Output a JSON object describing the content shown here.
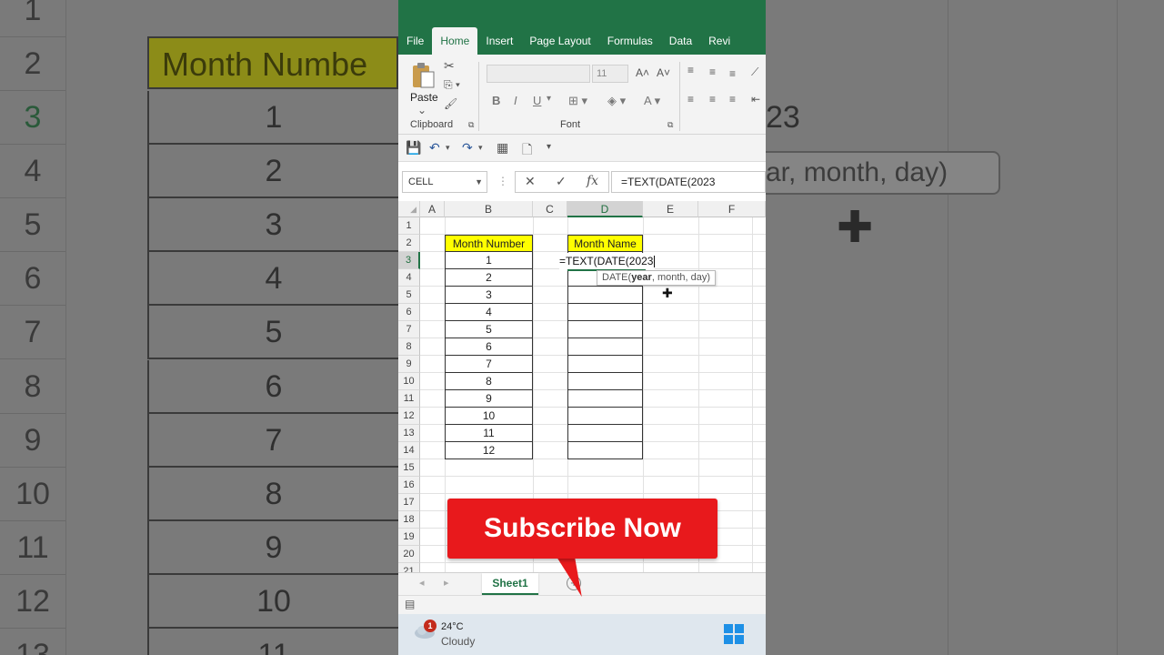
{
  "background": {
    "row_numbers": [
      "1",
      "2",
      "3",
      "4",
      "5",
      "6",
      "7",
      "8",
      "9",
      "10",
      "11",
      "12",
      "13"
    ],
    "header_text": "Month Numbe",
    "values": [
      "1",
      "2",
      "3",
      "4",
      "5",
      "6",
      "7",
      "8",
      "9",
      "10",
      "11"
    ],
    "right_cell_text": "23",
    "tooltip_text": "ar, month, day)"
  },
  "ribbon": {
    "tabs": [
      "File",
      "Home",
      "Insert",
      "Page Layout",
      "Formulas",
      "Data",
      "Revi"
    ],
    "active_tab": "Home",
    "paste_label": "Paste",
    "clipboard_label": "Clipboard",
    "font_label": "Font",
    "font_size": "11",
    "bold": "B",
    "italic": "I",
    "underline": "U"
  },
  "formula_bar": {
    "name_box": "CELL",
    "cancel": "✕",
    "enter": "✓",
    "fx": "fx",
    "formula": "=TEXT(DATE(2023"
  },
  "sheet": {
    "columns": [
      "A",
      "B",
      "C",
      "D",
      "E",
      "F"
    ],
    "active_column": "D",
    "rows": [
      "1",
      "2",
      "3",
      "4",
      "5",
      "6",
      "7",
      "8",
      "9",
      "10",
      "11",
      "12",
      "13",
      "14",
      "15",
      "16",
      "17",
      "18",
      "19",
      "20",
      "21"
    ],
    "active_row": "3",
    "header_b": "Month Number",
    "header_d": "Month Name",
    "month_numbers": [
      "1",
      "2",
      "3",
      "4",
      "5",
      "6",
      "7",
      "8",
      "9",
      "10",
      "11",
      "12"
    ],
    "editing_text": "=TEXT(DATE(2023",
    "tooltip_fn": "DATE(",
    "tooltip_bold": "year",
    "tooltip_rest": ", month, day)"
  },
  "sheet_tabs": {
    "active": "Sheet1",
    "add": "+"
  },
  "taskbar": {
    "badge": "1",
    "temperature": "24°C",
    "condition": "Cloudy"
  },
  "overlay": {
    "subscribe": "Subscribe Now"
  },
  "colors": {
    "excel_green": "#217346",
    "highlight_yellow": "#ffff00",
    "subscribe_red": "#e8191c"
  }
}
